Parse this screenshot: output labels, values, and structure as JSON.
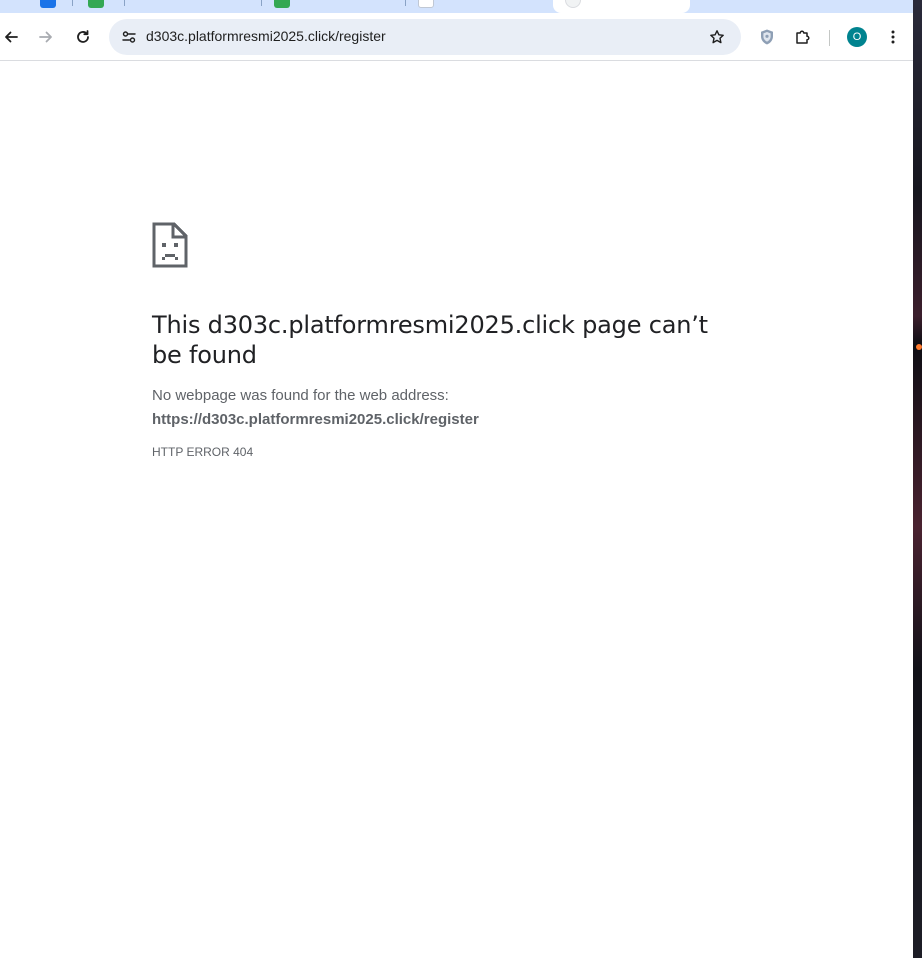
{
  "browser": {
    "address_bar": {
      "url": "d303c.platformresmi2025.click/register"
    },
    "profile_initial": "O"
  },
  "error_page": {
    "headline": "This d303c.platformresmi2025.click page can’t be found",
    "description": "No webpage was found for the web address:",
    "url": "https://d303c.platformresmi2025.click/register",
    "error_code": "HTTP ERROR 404"
  },
  "colors": {
    "tabstrip": "#d3e3fd",
    "omnibox": "#e9eef6",
    "avatar": "#00838f",
    "text_primary": "#202124",
    "text_secondary": "#5f6368"
  }
}
